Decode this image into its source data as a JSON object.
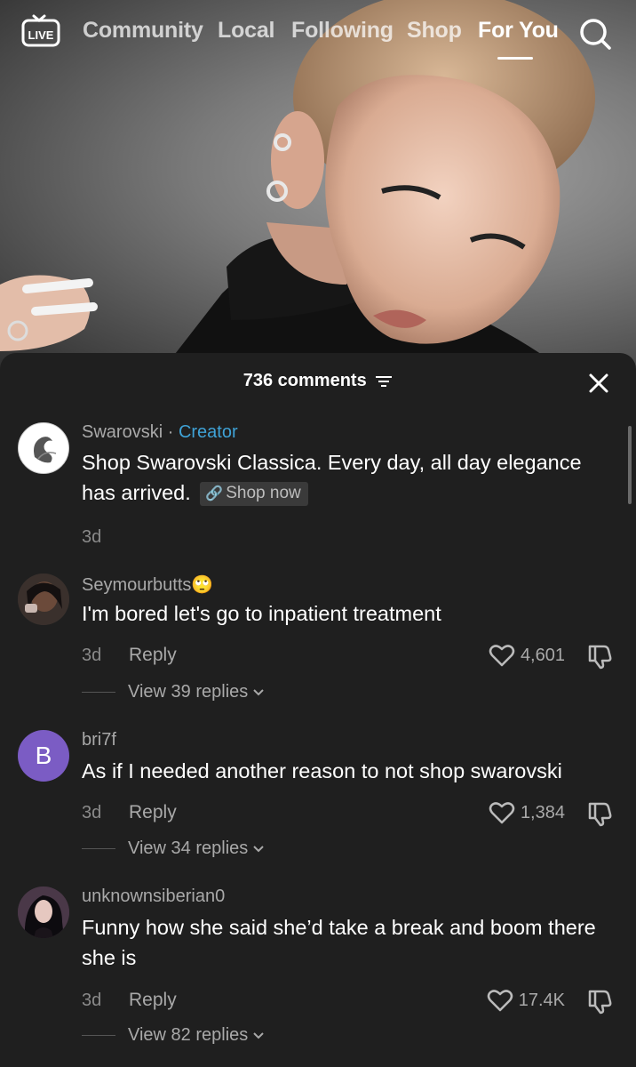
{
  "nav": {
    "live_label": "LIVE",
    "tabs": [
      {
        "label": "Community"
      },
      {
        "label": "Local"
      },
      {
        "label": "Following"
      },
      {
        "label": "Shop"
      },
      {
        "label": "For You",
        "active": true
      }
    ],
    "search_icon": "search-icon"
  },
  "comments_panel": {
    "title": "736 comments",
    "filter_icon": "filter-icon",
    "close_icon": "close-icon",
    "comments": [
      {
        "username": "Swarovski",
        "separator": "·",
        "tag": "Creator",
        "text": "Shop Swarovski Classica. Every day, all day elegance has arrived.",
        "link_label": "Shop now",
        "time": "3d"
      },
      {
        "username": "Seymourbutts",
        "emoji": "🙄",
        "text": "I'm bored let's go to inpatient treatment",
        "time": "3d",
        "reply_label": "Reply",
        "likes": "4,601",
        "view_replies": "View 39 replies"
      },
      {
        "username": "bri7f",
        "avatar_letter": "B",
        "text": "As if I needed another reason to not shop swarovski",
        "time": "3d",
        "reply_label": "Reply",
        "likes": "1,384",
        "view_replies": "View 34 replies"
      },
      {
        "username": "unknownsiberian0",
        "text": "Funny how she said she’d take a break and boom there she is",
        "time": "3d",
        "reply_label": "Reply",
        "likes": "17.4K",
        "view_replies": "View 82 replies"
      }
    ]
  },
  "colors": {
    "sheet_bg": "#1f1f1f",
    "creator_tag": "#3fa2d6",
    "avatar_b": "#7b5cc4",
    "muted_text": "#a9a9a9"
  }
}
